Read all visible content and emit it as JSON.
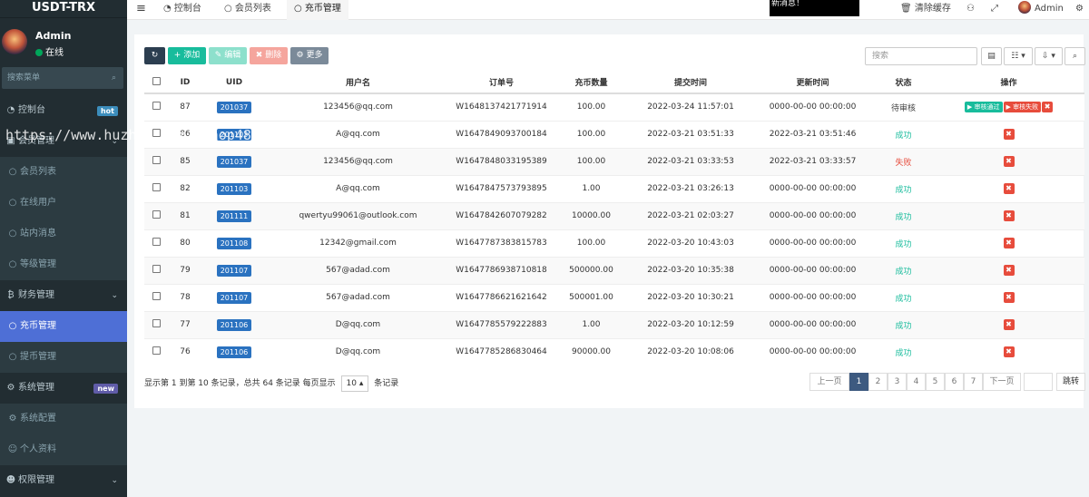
{
  "app": {
    "title": "USDT-TRX"
  },
  "user": {
    "name": "Admin",
    "status": "在线"
  },
  "sidebar": {
    "search_placeholder": "搜索菜单",
    "items": [
      {
        "label": "控制台",
        "badge": "hot",
        "icon": "dashboard-icon"
      },
      {
        "label": "会员管理",
        "icon": "user-group-icon"
      },
      {
        "label": "会员列表",
        "icon": "circle-icon"
      },
      {
        "label": "在线用户",
        "icon": "circle-icon"
      },
      {
        "label": "站内消息",
        "icon": "circle-icon"
      },
      {
        "label": "等级管理",
        "icon": "circle-icon"
      },
      {
        "label": "财务管理",
        "icon": "bitcoin-icon"
      },
      {
        "label": "充币管理",
        "icon": "circle-icon"
      },
      {
        "label": "提币管理",
        "icon": "circle-icon"
      },
      {
        "label": "系统管理",
        "badge": "new",
        "icon": "cogs-icon"
      },
      {
        "label": "系统配置",
        "icon": "gear-icon"
      },
      {
        "label": "个人资料",
        "icon": "user-icon"
      },
      {
        "label": "权限管理",
        "icon": "users-icon"
      }
    ]
  },
  "topbar": {
    "tabs": [
      {
        "label": "控制台",
        "icon": "dashboard-icon"
      },
      {
        "label": "会员列表",
        "icon": "circle-icon"
      },
      {
        "label": "充币管理",
        "icon": "circle-icon"
      }
    ],
    "notice": "新消息！",
    "clear_cache": "清除缓存",
    "admin_name": "Admin"
  },
  "toolbar": {
    "add": "添加",
    "edit": "编辑",
    "delete": "删除",
    "more": "更多",
    "search_placeholder": "搜索"
  },
  "table": {
    "headers": [
      "ID",
      "UID",
      "用户名",
      "订单号",
      "充币数量",
      "提交时间",
      "更新时间",
      "状态",
      "操作"
    ],
    "rows": [
      {
        "id": "87",
        "uid": "201037",
        "username": "123456@qq.com",
        "order": "W1648137421771914",
        "amount": "100.00",
        "submitted": "2022-03-24 11:57:01",
        "updated": "0000-00-00 00:00:00",
        "status": "待审核",
        "status_type": "wait"
      },
      {
        "id": "86",
        "uid": "201103",
        "username": "A@qq.com",
        "order": "W1647849093700184",
        "amount": "100.00",
        "submitted": "2022-03-21 03:51:33",
        "updated": "2022-03-21 03:51:46",
        "status": "成功",
        "status_type": "ok"
      },
      {
        "id": "85",
        "uid": "201037",
        "username": "123456@qq.com",
        "order": "W1647848033195389",
        "amount": "100.00",
        "submitted": "2022-03-21 03:33:53",
        "updated": "2022-03-21 03:33:57",
        "status": "失败",
        "status_type": "fail"
      },
      {
        "id": "82",
        "uid": "201103",
        "username": "A@qq.com",
        "order": "W1647847573793895",
        "amount": "1.00",
        "submitted": "2022-03-21 03:26:13",
        "updated": "0000-00-00 00:00:00",
        "status": "成功",
        "status_type": "ok"
      },
      {
        "id": "81",
        "uid": "201111",
        "username": "qwertyu99061@outlook.com",
        "order": "W1647842607079282",
        "amount": "10000.00",
        "submitted": "2022-03-21 02:03:27",
        "updated": "0000-00-00 00:00:00",
        "status": "成功",
        "status_type": "ok"
      },
      {
        "id": "80",
        "uid": "201108",
        "username": "12342@gmail.com",
        "order": "W1647787383815783",
        "amount": "100.00",
        "submitted": "2022-03-20 10:43:03",
        "updated": "0000-00-00 00:00:00",
        "status": "成功",
        "status_type": "ok"
      },
      {
        "id": "79",
        "uid": "201107",
        "username": "567@adad.com",
        "order": "W1647786938710818",
        "amount": "500000.00",
        "submitted": "2022-03-20 10:35:38",
        "updated": "0000-00-00 00:00:00",
        "status": "成功",
        "status_type": "ok"
      },
      {
        "id": "78",
        "uid": "201107",
        "username": "567@adad.com",
        "order": "W1647786621621642",
        "amount": "500001.00",
        "submitted": "2022-03-20 10:30:21",
        "updated": "0000-00-00 00:00:00",
        "status": "成功",
        "status_type": "ok"
      },
      {
        "id": "77",
        "uid": "201106",
        "username": "D@qq.com",
        "order": "W1647785579222883",
        "amount": "1.00",
        "submitted": "2022-03-20 10:12:59",
        "updated": "0000-00-00 00:00:00",
        "status": "成功",
        "status_type": "ok"
      },
      {
        "id": "76",
        "uid": "201106",
        "username": "D@qq.com",
        "order": "W1647785286830464",
        "amount": "90000.00",
        "submitted": "2022-03-20 10:08:06",
        "updated": "0000-00-00 00:00:00",
        "status": "成功",
        "status_type": "ok"
      }
    ],
    "approve_label": "审核通过",
    "reject_label": "审核失败"
  },
  "footer": {
    "info_prefix": "显示第 1 到第 10 条记录，总共 64 条记录 每页显示",
    "page_size": "10",
    "info_suffix": "条记录"
  },
  "pagination": {
    "prev": "上一页",
    "pages": [
      "1",
      "2",
      "3",
      "4",
      "5",
      "6",
      "7"
    ],
    "current": "1",
    "next": "下一页",
    "jump": "跳转"
  },
  "watermark": "https://www.huzhan.com/ishop48356",
  "colors": {
    "sidebar_bg": "#222d32",
    "active_menu": "#4e6fd6",
    "add_button": "#18bc9c",
    "delete_button": "#e74c3c",
    "uid_badge": "#2a72c0",
    "status_success": "#18bc9c",
    "status_fail": "#e74c3c"
  }
}
